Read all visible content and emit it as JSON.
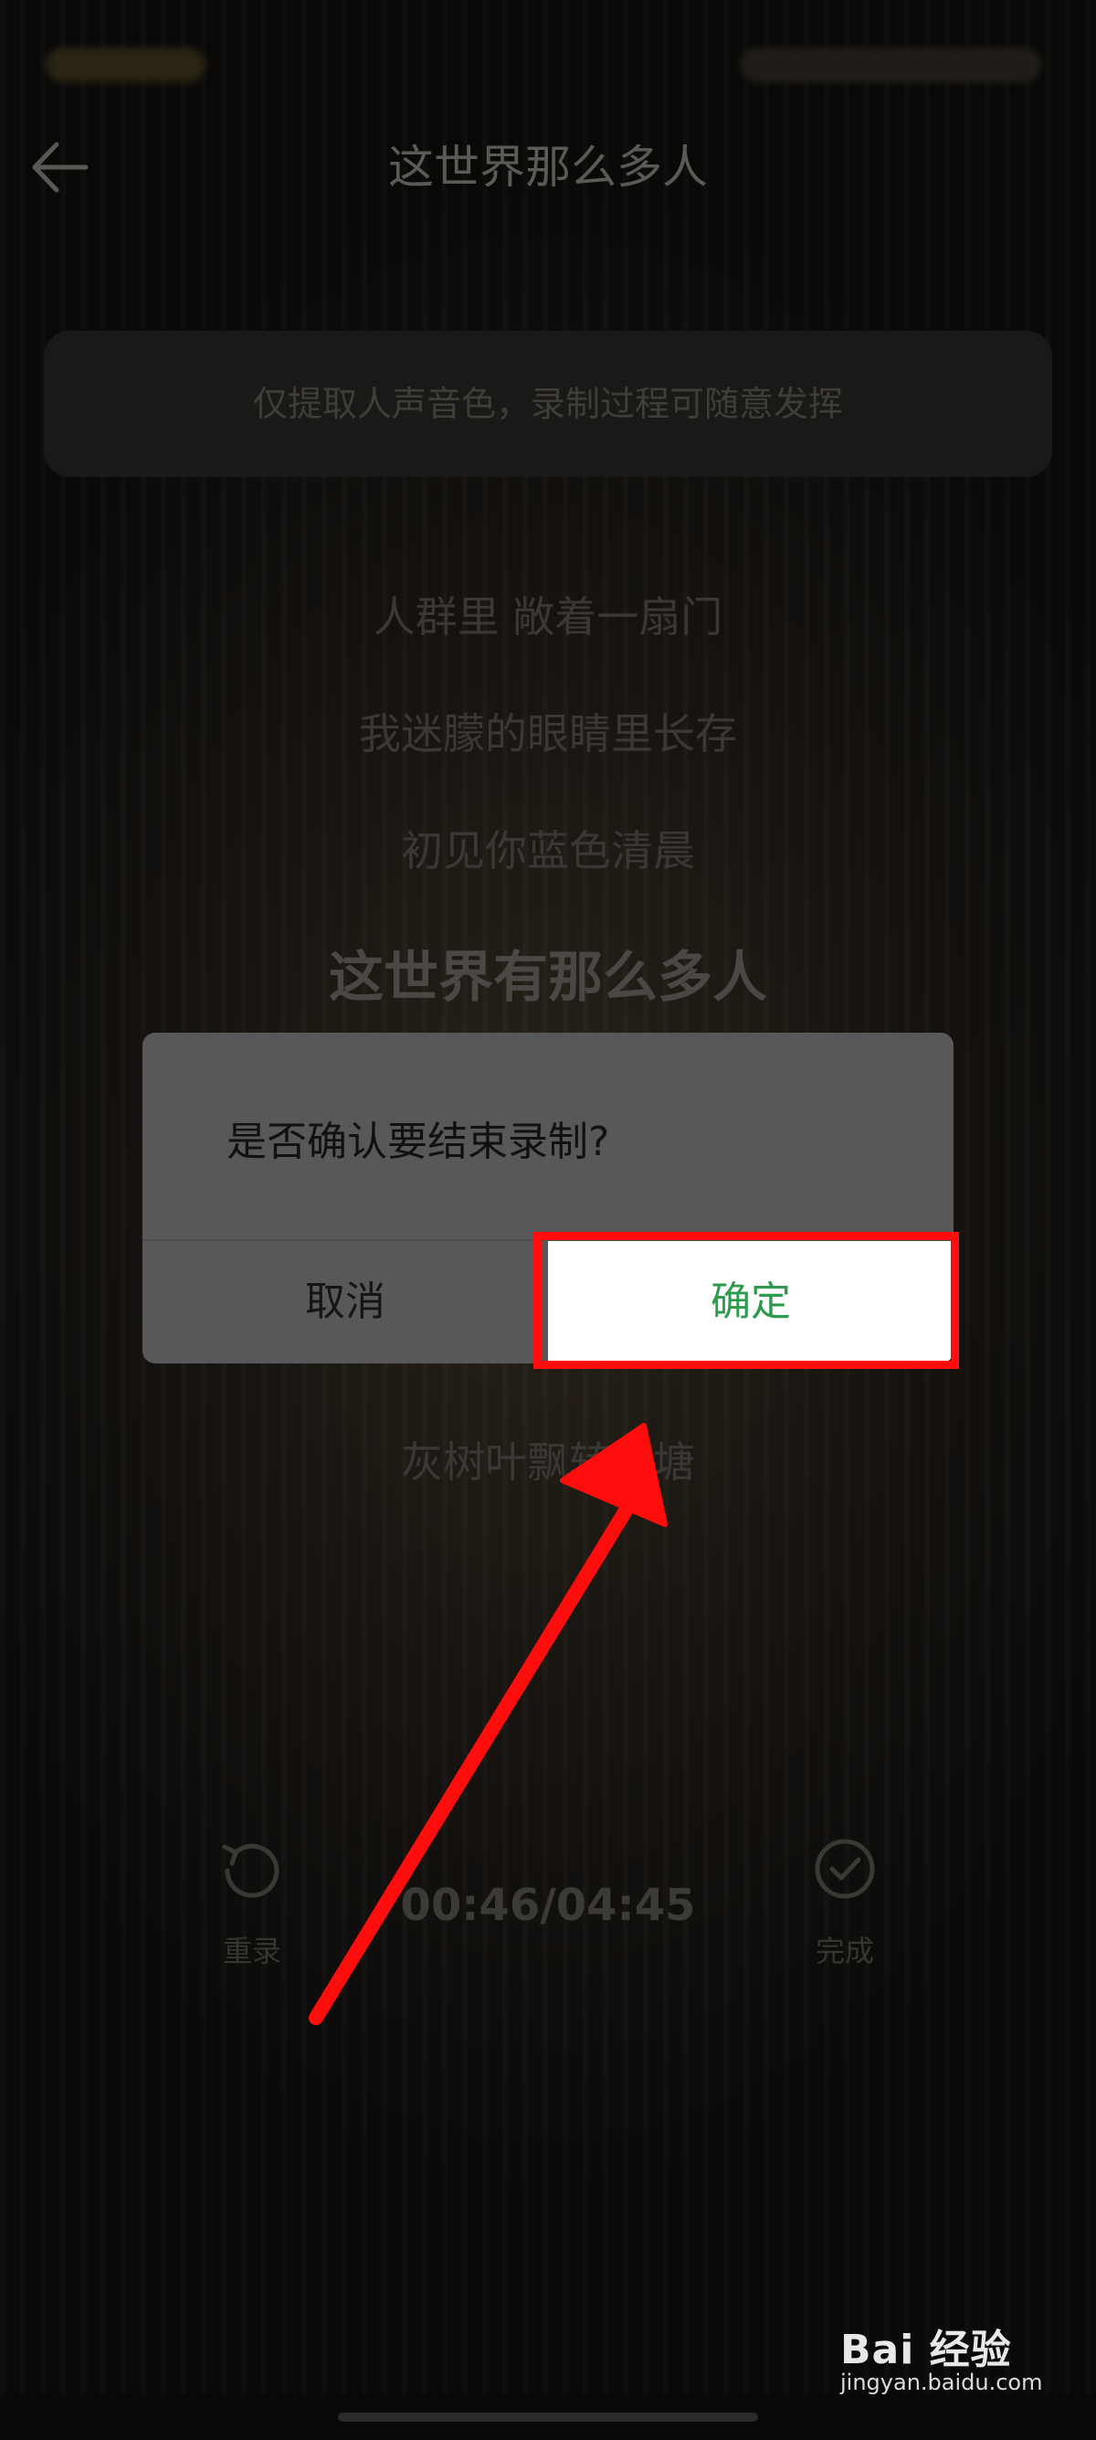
{
  "header": {
    "title": "这世界那么多人"
  },
  "tip": {
    "text": "仅提取人声音色，录制过程可随意发挥"
  },
  "lyrics": [
    "人群里 敞着一扇门",
    "我迷朦的眼睛里长存",
    "初见你蓝色清晨",
    "这世界有那么多人",
    "灰树叶飘转池塘"
  ],
  "controls": {
    "rerecord_label": "重录",
    "timer": "00:46/04:45",
    "finish_label": "完成"
  },
  "dialog": {
    "message": "是否确认要结束录制?",
    "cancel_label": "取消",
    "confirm_label": "确定"
  },
  "annotation": {
    "highlight_color": "#ff0d0d"
  },
  "watermark": {
    "brand": "Bai 经验",
    "url": "jingyan.baidu.com"
  }
}
